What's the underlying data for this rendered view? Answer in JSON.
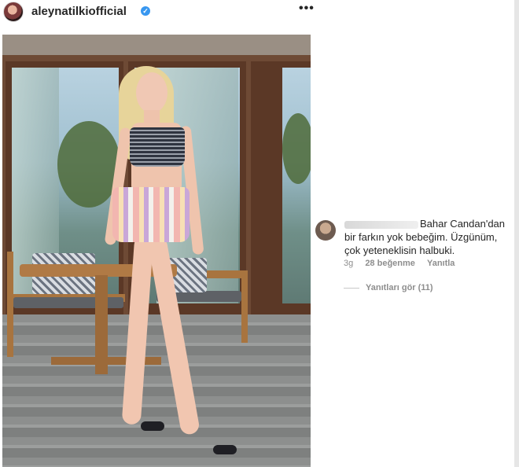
{
  "post": {
    "username": "aleynatilkiofficial",
    "verified_icon": "verified-badge-icon",
    "more_icon": "more-options-icon",
    "more_glyph": "•••"
  },
  "comment": {
    "text": "Bahar Candan'dan bir farkın yok bebeğim. Üzgünüm, çok yeteneklisin halbuki.",
    "time": "3g",
    "likes": "28 beğenme",
    "reply": "Yanıtla",
    "view_replies": "Yanıtları gör (11)"
  },
  "colors": {
    "verified": "#3897f0",
    "text_primary": "#262626",
    "text_secondary": "#8e8e8e"
  }
}
